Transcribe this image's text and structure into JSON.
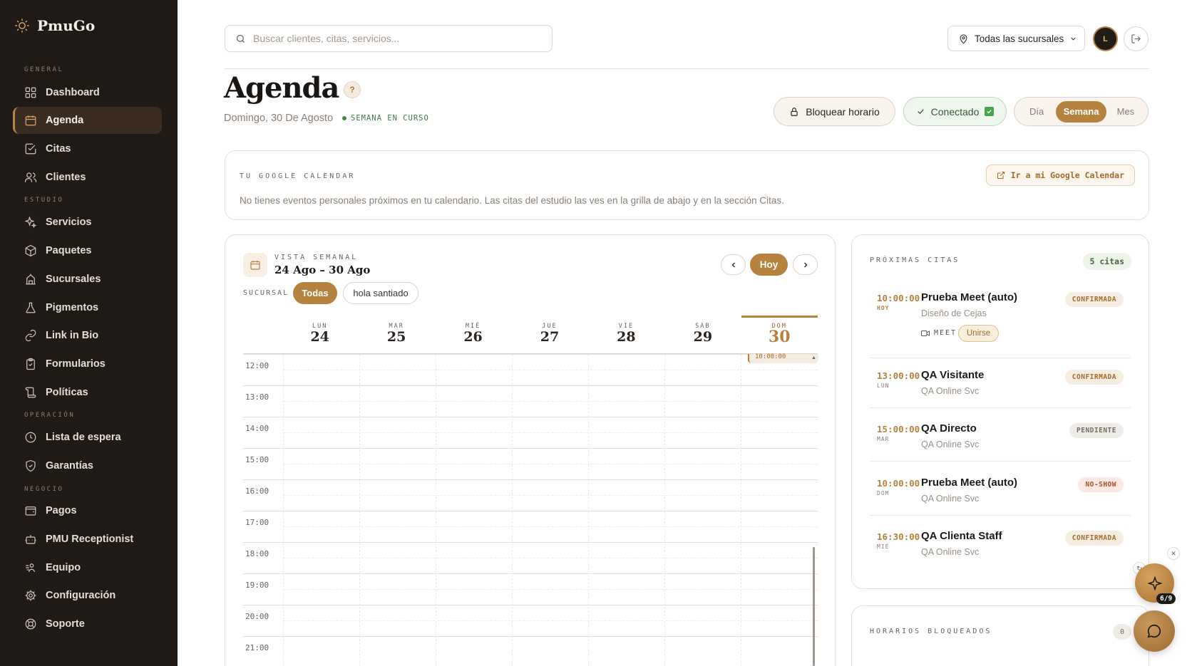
{
  "app": {
    "name": "PmuGo"
  },
  "sidebar": {
    "sections": {
      "general": "GENERAL",
      "estudio": "ESTUDIO",
      "operacion": "OPERACIÓN",
      "negocio": "NEGOCIO"
    },
    "items": [
      {
        "label": "Dashboard",
        "icon": "grid-icon"
      },
      {
        "label": "Agenda",
        "icon": "calendar-icon",
        "active": true
      },
      {
        "label": "Citas",
        "icon": "check-square-icon"
      },
      {
        "label": "Clientes",
        "icon": "users-icon"
      },
      {
        "label": "Servicios",
        "icon": "sparkles-icon"
      },
      {
        "label": "Paquetes",
        "icon": "package-icon"
      },
      {
        "label": "Sucursales",
        "icon": "building-icon"
      },
      {
        "label": "Pigmentos",
        "icon": "flask-icon"
      },
      {
        "label": "Link in Bio",
        "icon": "link-icon"
      },
      {
        "label": "Formularios",
        "icon": "clipboard-icon"
      },
      {
        "label": "Políticas",
        "icon": "scroll-icon"
      },
      {
        "label": "Lista de espera",
        "icon": "clock-icon"
      },
      {
        "label": "Garantías",
        "icon": "shield-check-icon"
      },
      {
        "label": "Pagos",
        "icon": "wallet-icon"
      },
      {
        "label": "PMU Receptionist",
        "icon": "bot-icon"
      },
      {
        "label": "Equipo",
        "icon": "team-icon"
      },
      {
        "label": "Configuración",
        "icon": "gear-icon"
      },
      {
        "label": "Soporte",
        "icon": "lifebuoy-icon"
      }
    ]
  },
  "header": {
    "search_placeholder": "Buscar clientes, citas, servicios...",
    "branch_select": "Todas las sucursales",
    "avatar_initial": "L"
  },
  "page": {
    "title": "Agenda",
    "help": "?",
    "date": "Domingo, 30 De Agosto",
    "week_badge": "SEMANA EN CURSO",
    "block_button": "Bloquear horario",
    "connected_button": "Conectado",
    "view_options": [
      "Día",
      "Semana",
      "Mes"
    ],
    "view_selected": "Semana"
  },
  "google_calendar": {
    "label": "TU GOOGLE CALENDAR",
    "text": "No tienes eventos personales próximos en tu calendario. Las citas del estudio las ves en la grilla de abajo y en la sección Citas.",
    "button": "Ir a mi Google Calendar"
  },
  "calendar": {
    "view_label": "VISTA SEMANAL",
    "range": "24 Ago – 30 Ago",
    "today_button": "Hoy",
    "branch_label": "SUCURSAL",
    "branch_chips": [
      "Todas",
      "hola santiado"
    ],
    "days": [
      {
        "name": "LUN",
        "num": "24"
      },
      {
        "name": "MAR",
        "num": "25"
      },
      {
        "name": "MIÉ",
        "num": "26"
      },
      {
        "name": "JUE",
        "num": "27"
      },
      {
        "name": "VIE",
        "num": "28"
      },
      {
        "name": "SÁB",
        "num": "29"
      },
      {
        "name": "DOM",
        "num": "30"
      }
    ],
    "hours": [
      "12:00",
      "13:00",
      "14:00",
      "15:00",
      "16:00",
      "17:00",
      "18:00",
      "19:00",
      "20:00",
      "21:00"
    ],
    "event_time": "10:00:00"
  },
  "proximas": {
    "label": "PRÓXIMAS CITAS",
    "count": "5 citas",
    "meet_label": "MEET",
    "join_label": "Unirse",
    "items": [
      {
        "time": "10:00:00",
        "day": "HOY",
        "name": "Prueba Meet (auto)",
        "service": "Diseño de Cejas",
        "status": "CONFIRMADA"
      },
      {
        "time": "13:00:00",
        "day": "LUN",
        "name": "QA Visitante",
        "service": "QA Online Svc",
        "status": "CONFIRMADA"
      },
      {
        "time": "15:00:00",
        "day": "MAR",
        "name": "QA Directo",
        "service": "QA Online Svc",
        "status": "PENDIENTE"
      },
      {
        "time": "10:00:00",
        "day": "DOM",
        "name": "Prueba Meet (auto)",
        "service": "QA Online Svc",
        "status": "NO-SHOW"
      },
      {
        "time": "16:30:00",
        "day": "MIÉ",
        "name": "QA Clienta Staff",
        "service": "QA Online Svc",
        "status": "CONFIRMADA"
      }
    ]
  },
  "bloqueados": {
    "label": "HORARIOS BLOQUEADOS",
    "count": "0"
  },
  "assistant": {
    "step": "6/9"
  },
  "colors": {
    "accent": "#b5823f",
    "sidebar": "#201a16",
    "success": "#3f8a4a"
  }
}
